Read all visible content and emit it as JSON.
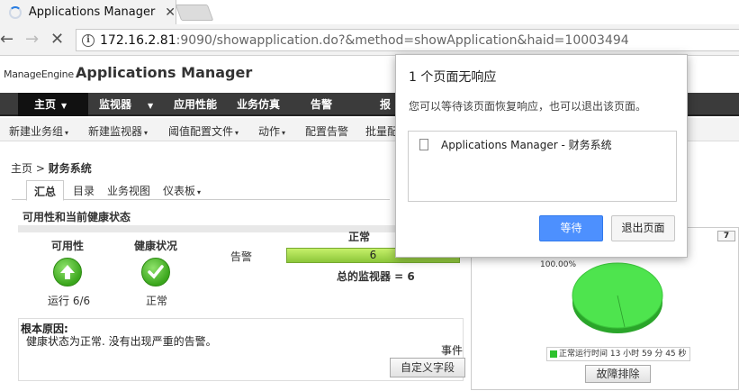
{
  "browser": {
    "tab_title": "Applications Manager -",
    "url_host": "172.16.2.81",
    "url_rest": ":9090/showapplication.do?&method=showApplication&haid=10003494"
  },
  "app": {
    "brand_small": "ManageEngine",
    "brand_name": "Applications Manager",
    "main_nav": [
      "主页",
      "监视器",
      "应用性能",
      "业务仿真",
      "告警",
      "报"
    ],
    "sub_nav": [
      "新建业务组",
      "新建监视器",
      "阈值配置文件",
      "动作",
      "配置告警",
      "批量配"
    ]
  },
  "page": {
    "breadcrumb_home": "主页",
    "breadcrumb_sep": ">",
    "breadcrumb_current": "财务系统",
    "tabs": [
      "汇总",
      "目录",
      "业务视图",
      "仪表板"
    ],
    "section_title": "可用性和当前健康状态",
    "availability_label": "可用性",
    "health_label": "健康状况",
    "availability_status": "运行 6/6",
    "health_status": "正常",
    "alarm_label": "告警",
    "normal_label": "正常",
    "bar_value": "6",
    "total_monitors": "总的监视器 = 6",
    "root_cause_title": "根本原因:",
    "root_cause_text": "健康状态为正常. 没有出现严重的告警。",
    "events_label": "事件",
    "custom_fields_button": "自定义字段"
  },
  "chart": {
    "period_button": "7",
    "percent_label": "100.00%",
    "legend_text": "正常运行时间 13 小时 59 分 45 秒",
    "troubleshoot_button": "故障排除",
    "up_color": "#3ddc3d"
  },
  "dialog": {
    "title": "1 个页面无响应",
    "message": "您可以等待该页面恢复响应，也可以退出该页面。",
    "page_item": "Applications Manager - 财务系统",
    "wait_button": "等待",
    "exit_button": "退出页面"
  }
}
